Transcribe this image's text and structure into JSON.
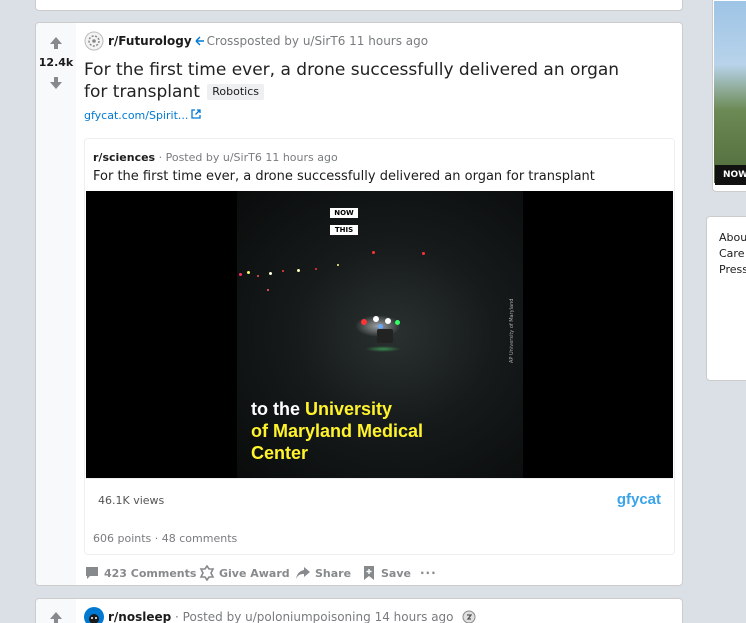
{
  "post": {
    "score": "12.4k",
    "subreddit": "r/Futurology",
    "crosspost_prefix": "Crossposted by",
    "user": "u/SirT6",
    "time": "11 hours ago",
    "title": "For the first time ever, a drone successfully delivered an organ for transplant",
    "flair": "Robotics",
    "link_text": "gfycat.com/Spirit...",
    "crosspost": {
      "subreddit": "r/sciences",
      "posted_prefix": "· Posted by",
      "user": "u/SirT6",
      "time": "11 hours ago",
      "title": "For the first time ever, a drone successfully delivered an organ for transplant",
      "video": {
        "badge_1": "NOW",
        "badge_2": "THIS",
        "caption_line1_white": "to the ",
        "caption_line1_yellow": "University",
        "caption_line2": "of Maryland Medical",
        "caption_line3": "Center",
        "credit": "AP  University of Maryland"
      },
      "views": "46.1K views",
      "provider": "gfycat",
      "points": "606 points · 48 comments"
    },
    "actions": {
      "comments": "423 Comments",
      "award": "Give Award",
      "share": "Share",
      "save": "Save",
      "more": "···"
    }
  },
  "next_post": {
    "subreddit": "r/nosleep",
    "posted_prefix": "· Posted by",
    "user": "u/poloniumpoisoning",
    "time": "14 hours ago"
  },
  "sidebar": {
    "ad_label": "NOW",
    "links": [
      "Abou",
      "Care",
      "Press"
    ]
  },
  "colors": {
    "background": "#dae0e6",
    "link_blue": "#0079d3",
    "caption_yellow": "#fff32b",
    "gfycat_blue": "#3aa3ea"
  }
}
